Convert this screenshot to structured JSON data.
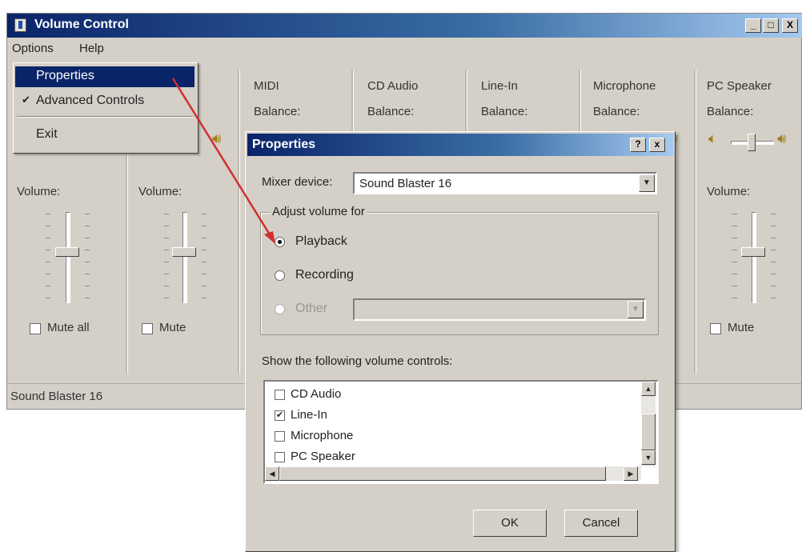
{
  "main_window": {
    "title": "Volume Control",
    "menu": [
      "Options",
      "Help"
    ],
    "caption_buttons": [
      "_",
      "□",
      "X"
    ],
    "columns": [
      {
        "title": "",
        "balance": "",
        "volume": "Volume:",
        "mute": "Mute all"
      },
      {
        "title": "",
        "balance": "",
        "volume": "Volume:",
        "mute": "Mute"
      },
      {
        "title": "MIDI",
        "balance": "Balance:"
      },
      {
        "title": "CD Audio",
        "balance": "Balance:"
      },
      {
        "title": "Line-In",
        "balance": "Balance:"
      },
      {
        "title": "Microphone",
        "balance": "Balance:"
      },
      {
        "title": "PC Speaker",
        "balance": "Balance:",
        "volume": "Volume:",
        "mute": "Mute"
      }
    ],
    "status": "Sound Blaster 16"
  },
  "options_menu": {
    "items": [
      {
        "label": "Properties",
        "highlighted": true
      },
      {
        "label": "Advanced Controls",
        "checked": true,
        "check_glyph": "✔"
      },
      {
        "label": "Exit"
      }
    ]
  },
  "properties_dialog": {
    "title": "Properties",
    "help_button": "?",
    "close_button": "x",
    "mixer_label": "Mixer device:",
    "mixer_value": "Sound Blaster 16",
    "adjust_group": "Adjust volume for",
    "radio_playback": "Playback",
    "radio_recording": "Recording",
    "radio_other": "Other",
    "selected_radio": "Playback",
    "controls_label": "Show the following volume controls:",
    "controls": [
      {
        "label": "CD Audio",
        "checked": false
      },
      {
        "label": "Line-In",
        "checked": true
      },
      {
        "label": "Microphone",
        "checked": false
      },
      {
        "label": "PC Speaker",
        "checked": false
      }
    ],
    "check_glyph": "✔",
    "ok": "OK",
    "cancel": "Cancel"
  },
  "colors": {
    "title_bar": "#0a246a",
    "face": "#d4d0c8",
    "annotation_arrow": "#d03030"
  }
}
